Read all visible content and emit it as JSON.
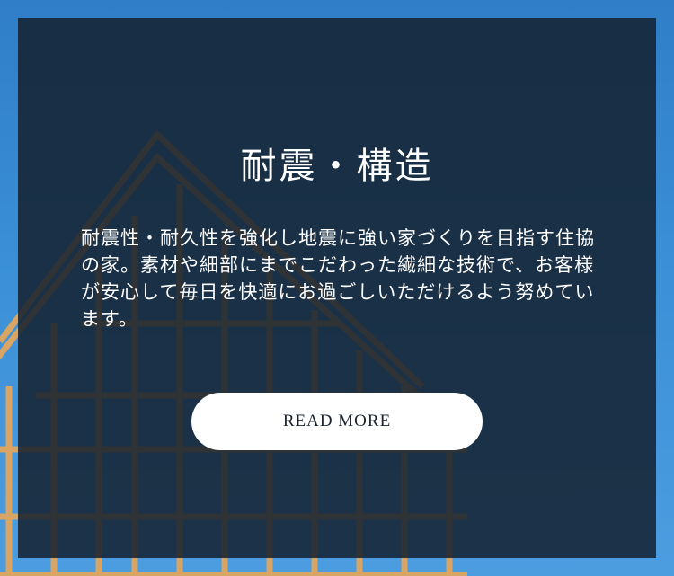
{
  "section": {
    "title": "耐震・構造",
    "description": "耐震性・耐久性を強化し地震に強い家づくりを目指す住協の家。素材や細部にまでこだわった繊細な技術で、お客様が安心して毎日を快適にお過ごしいただけるよう努めています。",
    "button_label": "READ MORE"
  },
  "background": {
    "image": "house-frame-under-construction",
    "sky_color": "#3a8fd6",
    "overlay_color": "#14212e"
  }
}
